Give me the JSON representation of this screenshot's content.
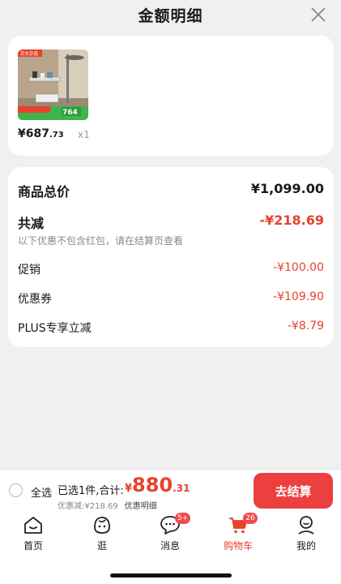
{
  "sheet": {
    "title": "金额明细"
  },
  "product": {
    "price_main": "¥687",
    "price_cents": ".73",
    "quantity": "x1",
    "thumb_badge": "京东京造",
    "thumb_price": "764"
  },
  "summary": {
    "total_label": "商品总价",
    "total_value": "¥1,099.00",
    "discount_label": "共减",
    "discount_value": "-¥218.69",
    "note": "以下优惠不包含红包，请在结算页查看",
    "items": [
      {
        "label": "促销",
        "value": "-¥100.00"
      },
      {
        "label": "优惠券",
        "value": "-¥109.90"
      },
      {
        "label": "PLUS专享立减",
        "value": "-¥8.79"
      }
    ]
  },
  "checkout_bar": {
    "select_all": "全选",
    "selected_text": "已选1件,合计:",
    "currency": "¥",
    "amount": "880",
    "cents": ".31",
    "saved_text": "优惠减:¥218.69",
    "detail_link": "优惠明细",
    "checkout_button": "去结算"
  },
  "tabs": [
    {
      "label": "首页",
      "icon": "home-icon"
    },
    {
      "label": "逛",
      "icon": "stroll-face-icon"
    },
    {
      "label": "消息",
      "icon": "message-icon",
      "badge": "5+"
    },
    {
      "label": "购物车",
      "icon": "cart-icon",
      "badge": "26",
      "active": true
    },
    {
      "label": "我的",
      "icon": "profile-icon"
    }
  ],
  "colors": {
    "accent": "#e8412c",
    "button": "#ec3f3f"
  }
}
